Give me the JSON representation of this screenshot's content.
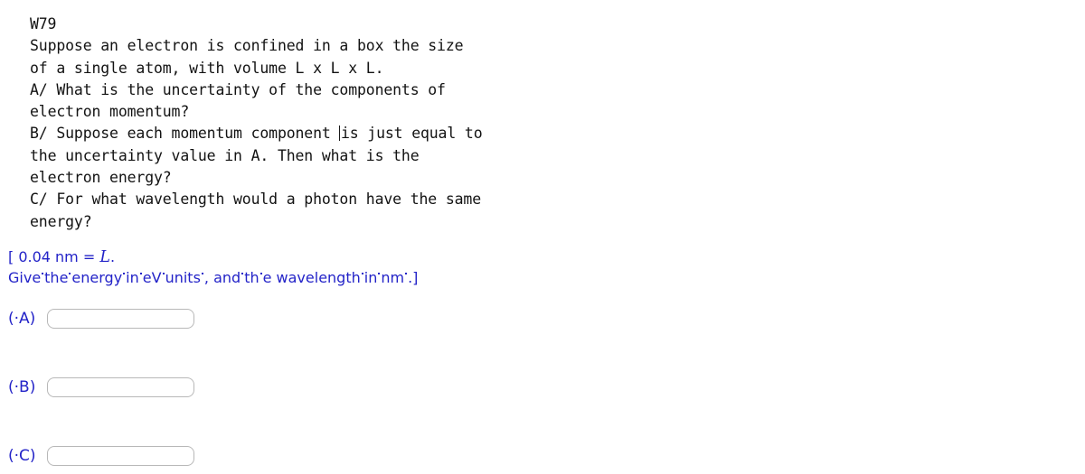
{
  "problem": {
    "id": "W79",
    "lines": [
      "Suppose an electron is confined in a box the size",
      "of a single atom, with volume L x L x L.",
      "A/ What is the uncertainty of the components of",
      "electron momentum?"
    ],
    "line_b_before_caret": "B/ Suppose each momentum component ",
    "line_b_after_caret": "is just equal to",
    "lines_after": [
      "the uncertainty value in A. Then what is the",
      "electron energy?",
      "C/ For what wavelength would a photon have the same",
      "energy?"
    ]
  },
  "instructions": {
    "line1_prefix": "[ 0.04 nm = ",
    "line1_variable": "L",
    "line1_suffix": ".",
    "line2_seg1": "Give",
    "line2_seg2": "the",
    "line2_seg3": "energy",
    "line2_seg4": "in",
    "line2_seg5": "eV",
    "line2_seg6": "units",
    "line2_seg7": ", and",
    "line2_seg8": "th",
    "line2_seg9": "e wavelength",
    "line2_seg10": "in",
    "line2_seg11": "nm",
    "line2_seg12": ".]"
  },
  "answers": [
    {
      "label": "(·A)",
      "value": "",
      "placeholder": ""
    },
    {
      "label": "(·B)",
      "value": "",
      "placeholder": ""
    },
    {
      "label": "(·C)",
      "value": "",
      "placeholder": ""
    }
  ],
  "colors": {
    "blue": "#2323c8",
    "text": "#131313",
    "input_border": "#b8b8b8",
    "background": "#ffffff"
  }
}
